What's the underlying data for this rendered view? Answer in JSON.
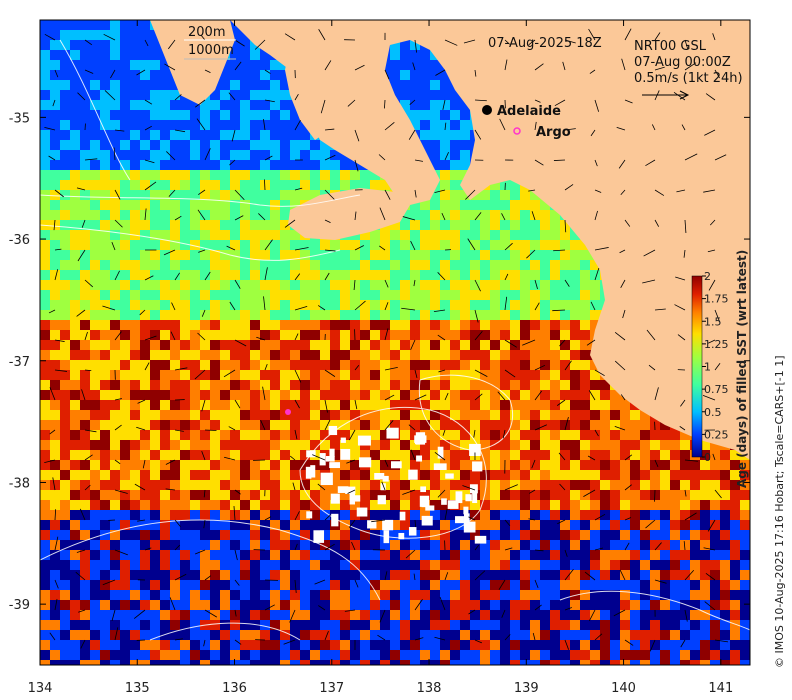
{
  "map": {
    "date_label": "07-Aug-2025 18Z",
    "legend_box": {
      "depth_200": "200m",
      "depth_1000": "1000m"
    },
    "product_info": {
      "line1": "NRT00 GSL",
      "line2": "07-Aug 00:00Z",
      "line3": "0.5m/s (1kt 24h)"
    },
    "markers": [
      {
        "label": "Adelaide",
        "kind": "city",
        "lon": 138.6,
        "lat": -34.93
      },
      {
        "label": "Argo",
        "kind": "float",
        "lon": 138.8,
        "lat": -35.12
      }
    ],
    "argo_symbol_color": "#ff33cc"
  },
  "axes": {
    "x_ticks": [
      "134",
      "135",
      "136",
      "137",
      "138",
      "139",
      "140",
      "141"
    ],
    "y_ticks": [
      "-35",
      "-36",
      "-37",
      "-38",
      "-39"
    ],
    "lon_range": [
      134,
      141.3
    ],
    "lat_range": [
      -39.5,
      -34.2
    ]
  },
  "colorbar": {
    "label": "Age (days) of filled SST (wrt latest)",
    "ticks": [
      "2",
      "1.75",
      "1.5",
      "1.25",
      "1",
      "0.75",
      "0.5",
      "0.25",
      "0"
    ],
    "range": [
      0,
      2
    ],
    "colors": [
      "#00008f",
      "#0040ff",
      "#00bfff",
      "#40ff9f",
      "#9fff40",
      "#ffdf00",
      "#ff7f00",
      "#df1f00",
      "#8f0000"
    ]
  },
  "credit": "© IMOS 10-Aug-2025 17:16 Hobart; Tscale=CARS+[-1 1]",
  "land_color": "#fbc898"
}
